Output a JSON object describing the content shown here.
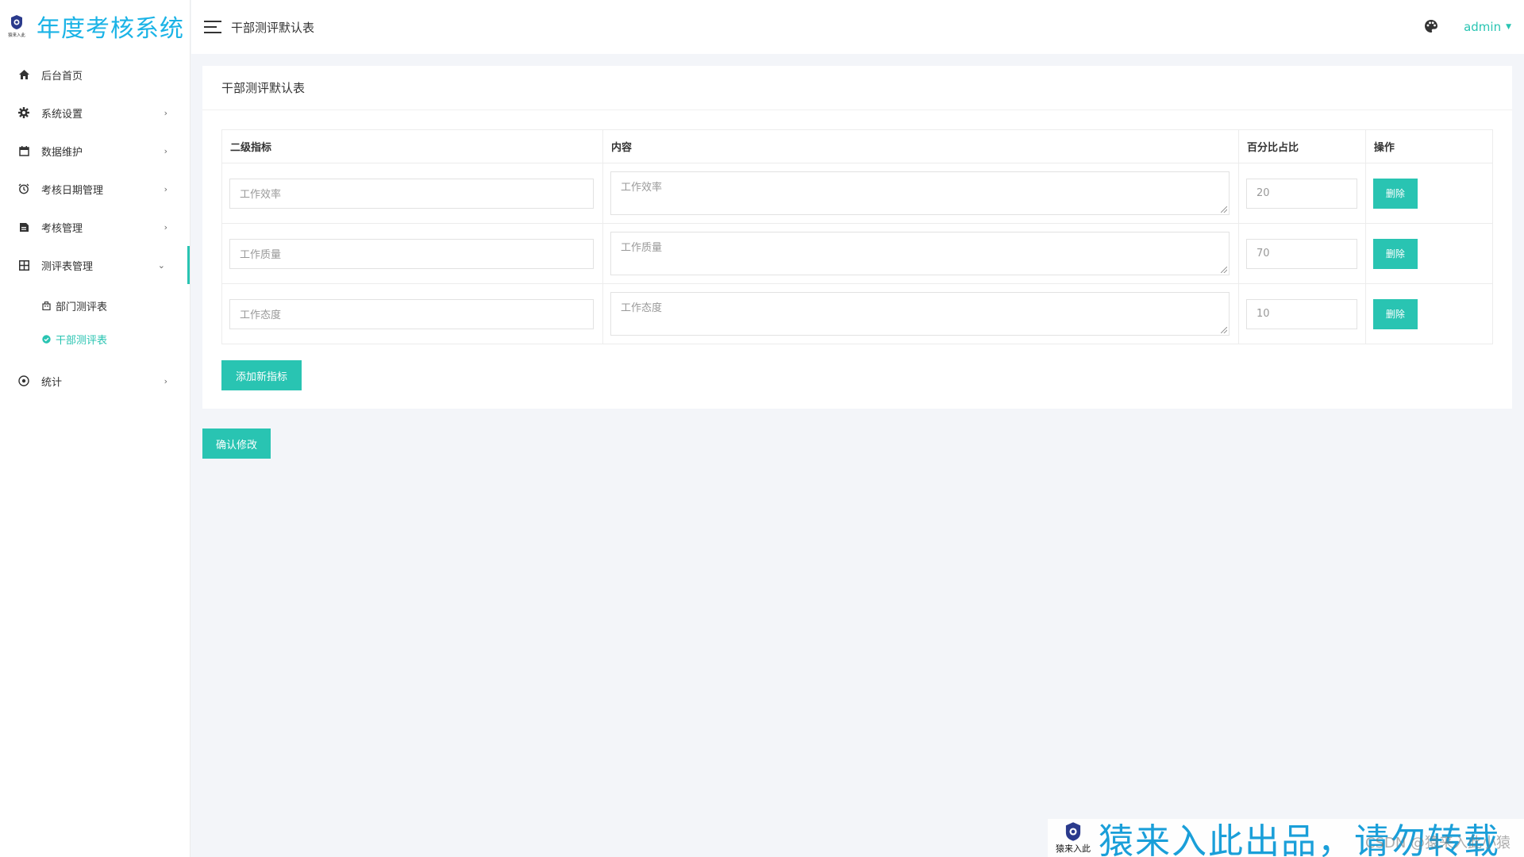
{
  "brand": {
    "logo_text": "猿来入此",
    "title": "年度考核系统"
  },
  "topbar": {
    "title": "干部测评默认表",
    "user": "admin"
  },
  "sidebar": {
    "items": [
      {
        "label": "后台首页",
        "icon": "home-icon"
      },
      {
        "label": "系统设置",
        "icon": "gear-icon",
        "arrow": "›"
      },
      {
        "label": "数据维护",
        "icon": "calendar-icon",
        "arrow": "›"
      },
      {
        "label": "考核日期管理",
        "icon": "alarm-clock-icon",
        "arrow": "›"
      },
      {
        "label": "考核管理",
        "icon": "document-icon",
        "arrow": "›"
      },
      {
        "label": "测评表管理",
        "icon": "grid-icon",
        "arrow": "⌄"
      },
      {
        "label": "统计",
        "icon": "target-icon",
        "arrow": "›"
      }
    ],
    "subitems": [
      {
        "label": "部门测评表",
        "icon": "building-icon"
      },
      {
        "label": "干部测评表",
        "icon": "check-circle-icon"
      }
    ]
  },
  "card": {
    "title": "干部测评默认表",
    "headers": [
      "二级指标",
      "内容",
      "百分比占比",
      "操作"
    ],
    "rows": [
      {
        "indicator": "工作效率",
        "content": "工作效率",
        "percent": "20",
        "action": "删除"
      },
      {
        "indicator": "工作质量",
        "content": "工作质量",
        "percent": "70",
        "action": "删除"
      },
      {
        "indicator": "工作态度",
        "content": "工作态度",
        "percent": "10",
        "action": "删除"
      }
    ],
    "add_button": "添加新指标"
  },
  "confirm_button": "确认修改",
  "watermark": {
    "logo_text": "猿来入此",
    "text": "猿来入此出品，请勿转载",
    "csdn": "CSDN @猿来入此小猿"
  },
  "colors": {
    "accent": "#29c4b2",
    "brand": "#1ab3e6"
  }
}
